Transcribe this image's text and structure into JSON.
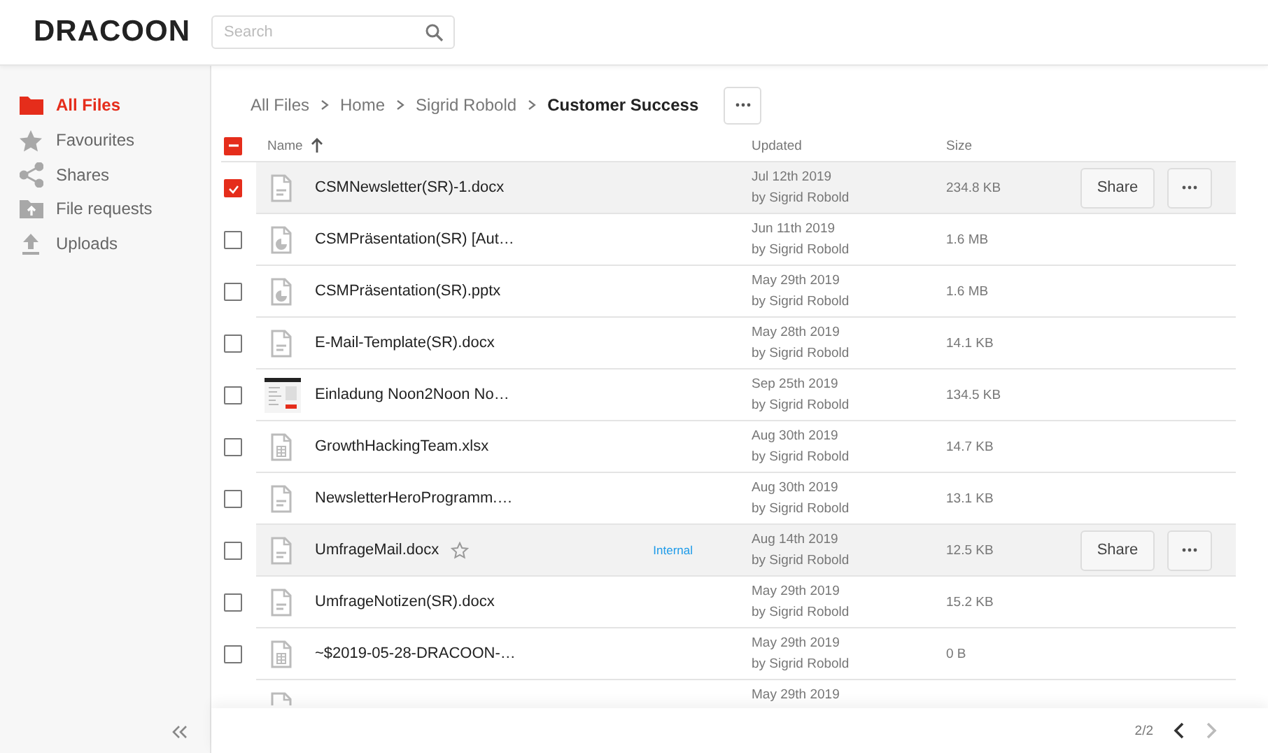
{
  "header": {
    "logo": "DRACOON",
    "search": {
      "placeholder": "Search"
    }
  },
  "sidebar": {
    "items": [
      {
        "label": "All Files",
        "kind": "folder",
        "selected": true
      },
      {
        "label": "Favourites",
        "kind": "favourites",
        "selected": false
      },
      {
        "label": "Shares",
        "kind": "shares",
        "selected": false
      },
      {
        "label": "File requests",
        "kind": "requests",
        "selected": false
      },
      {
        "label": "Uploads",
        "kind": "uploads",
        "selected": false
      }
    ]
  },
  "breadcrumb": [
    {
      "label": "All Files",
      "current": false
    },
    {
      "label": "Home",
      "current": false
    },
    {
      "label": "Sigrid Robold",
      "current": false
    },
    {
      "label": "Customer Success",
      "current": true
    }
  ],
  "table": {
    "select_all_checked": true,
    "select_all_indeterminate": true,
    "columns": [
      {
        "label": "Name",
        "sorted": true,
        "ascending": true
      },
      {
        "label": "Updated"
      },
      {
        "label": "Size"
      }
    ],
    "rows": [
      {
        "name": "CSMNewsletter(SR)-1.docx",
        "kind": "doc",
        "checked": true,
        "highlighted": true,
        "updated": "Jul 12th 2019",
        "by": "by Sigrid Robold",
        "size": "234.8 KB",
        "share": "Share"
      },
      {
        "name": "CSMPräsentation(SR) [Aut…",
        "kind": "presentation",
        "checked": false,
        "highlighted": false,
        "updated": "Jun 11th 2019",
        "by": "by Sigrid Robold",
        "size": "1.6 MB"
      },
      {
        "name": "CSMPräsentation(SR).pptx",
        "kind": "presentation",
        "checked": false,
        "highlighted": false,
        "updated": "May 29th 2019",
        "by": "by Sigrid Robold",
        "size": "1.6 MB"
      },
      {
        "name": "E-Mail-Template(SR).docx",
        "kind": "doc",
        "checked": false,
        "highlighted": false,
        "updated": "May 28th 2019",
        "by": "by Sigrid Robold",
        "size": "14.1 KB"
      },
      {
        "name": "Einladung Noon2Noon No…",
        "kind": "image",
        "checked": false,
        "highlighted": false,
        "updated": "Sep 25th 2019",
        "by": "by Sigrid Robold",
        "size": "134.5 KB"
      },
      {
        "name": "GrowthHackingTeam.xlsx",
        "kind": "sheet",
        "checked": false,
        "highlighted": false,
        "updated": "Aug 30th 2019",
        "by": "by Sigrid Robold",
        "size": "14.7 KB"
      },
      {
        "name": "NewsletterHeroProgramm.…",
        "kind": "doc",
        "checked": false,
        "highlighted": false,
        "updated": "Aug 30th 2019",
        "by": "by Sigrid Robold",
        "size": "13.1 KB"
      },
      {
        "name": "UmfrageMail.docx",
        "kind": "doc",
        "checked": false,
        "highlighted": true,
        "favourite": false,
        "badge": "Internal",
        "updated": "Aug 14th 2019",
        "by": "by Sigrid Robold",
        "size": "12.5 KB",
        "share": "Share"
      },
      {
        "name": "UmfrageNotizen(SR).docx",
        "kind": "doc",
        "checked": false,
        "highlighted": false,
        "updated": "May 29th 2019",
        "by": "by Sigrid Robold",
        "size": "15.2 KB"
      },
      {
        "name": "~$2019-05-28-DRACOON-…",
        "kind": "sheet",
        "checked": false,
        "highlighted": false,
        "updated": "May 29th 2019",
        "by": "by Sigrid Robold",
        "size": "0 B"
      },
      {
        "kind": "doc",
        "highlighted": false,
        "updated": "May 29th 2019"
      }
    ]
  },
  "pagination": {
    "page": "2/2",
    "prev_disabled": false,
    "next_disabled": true
  }
}
